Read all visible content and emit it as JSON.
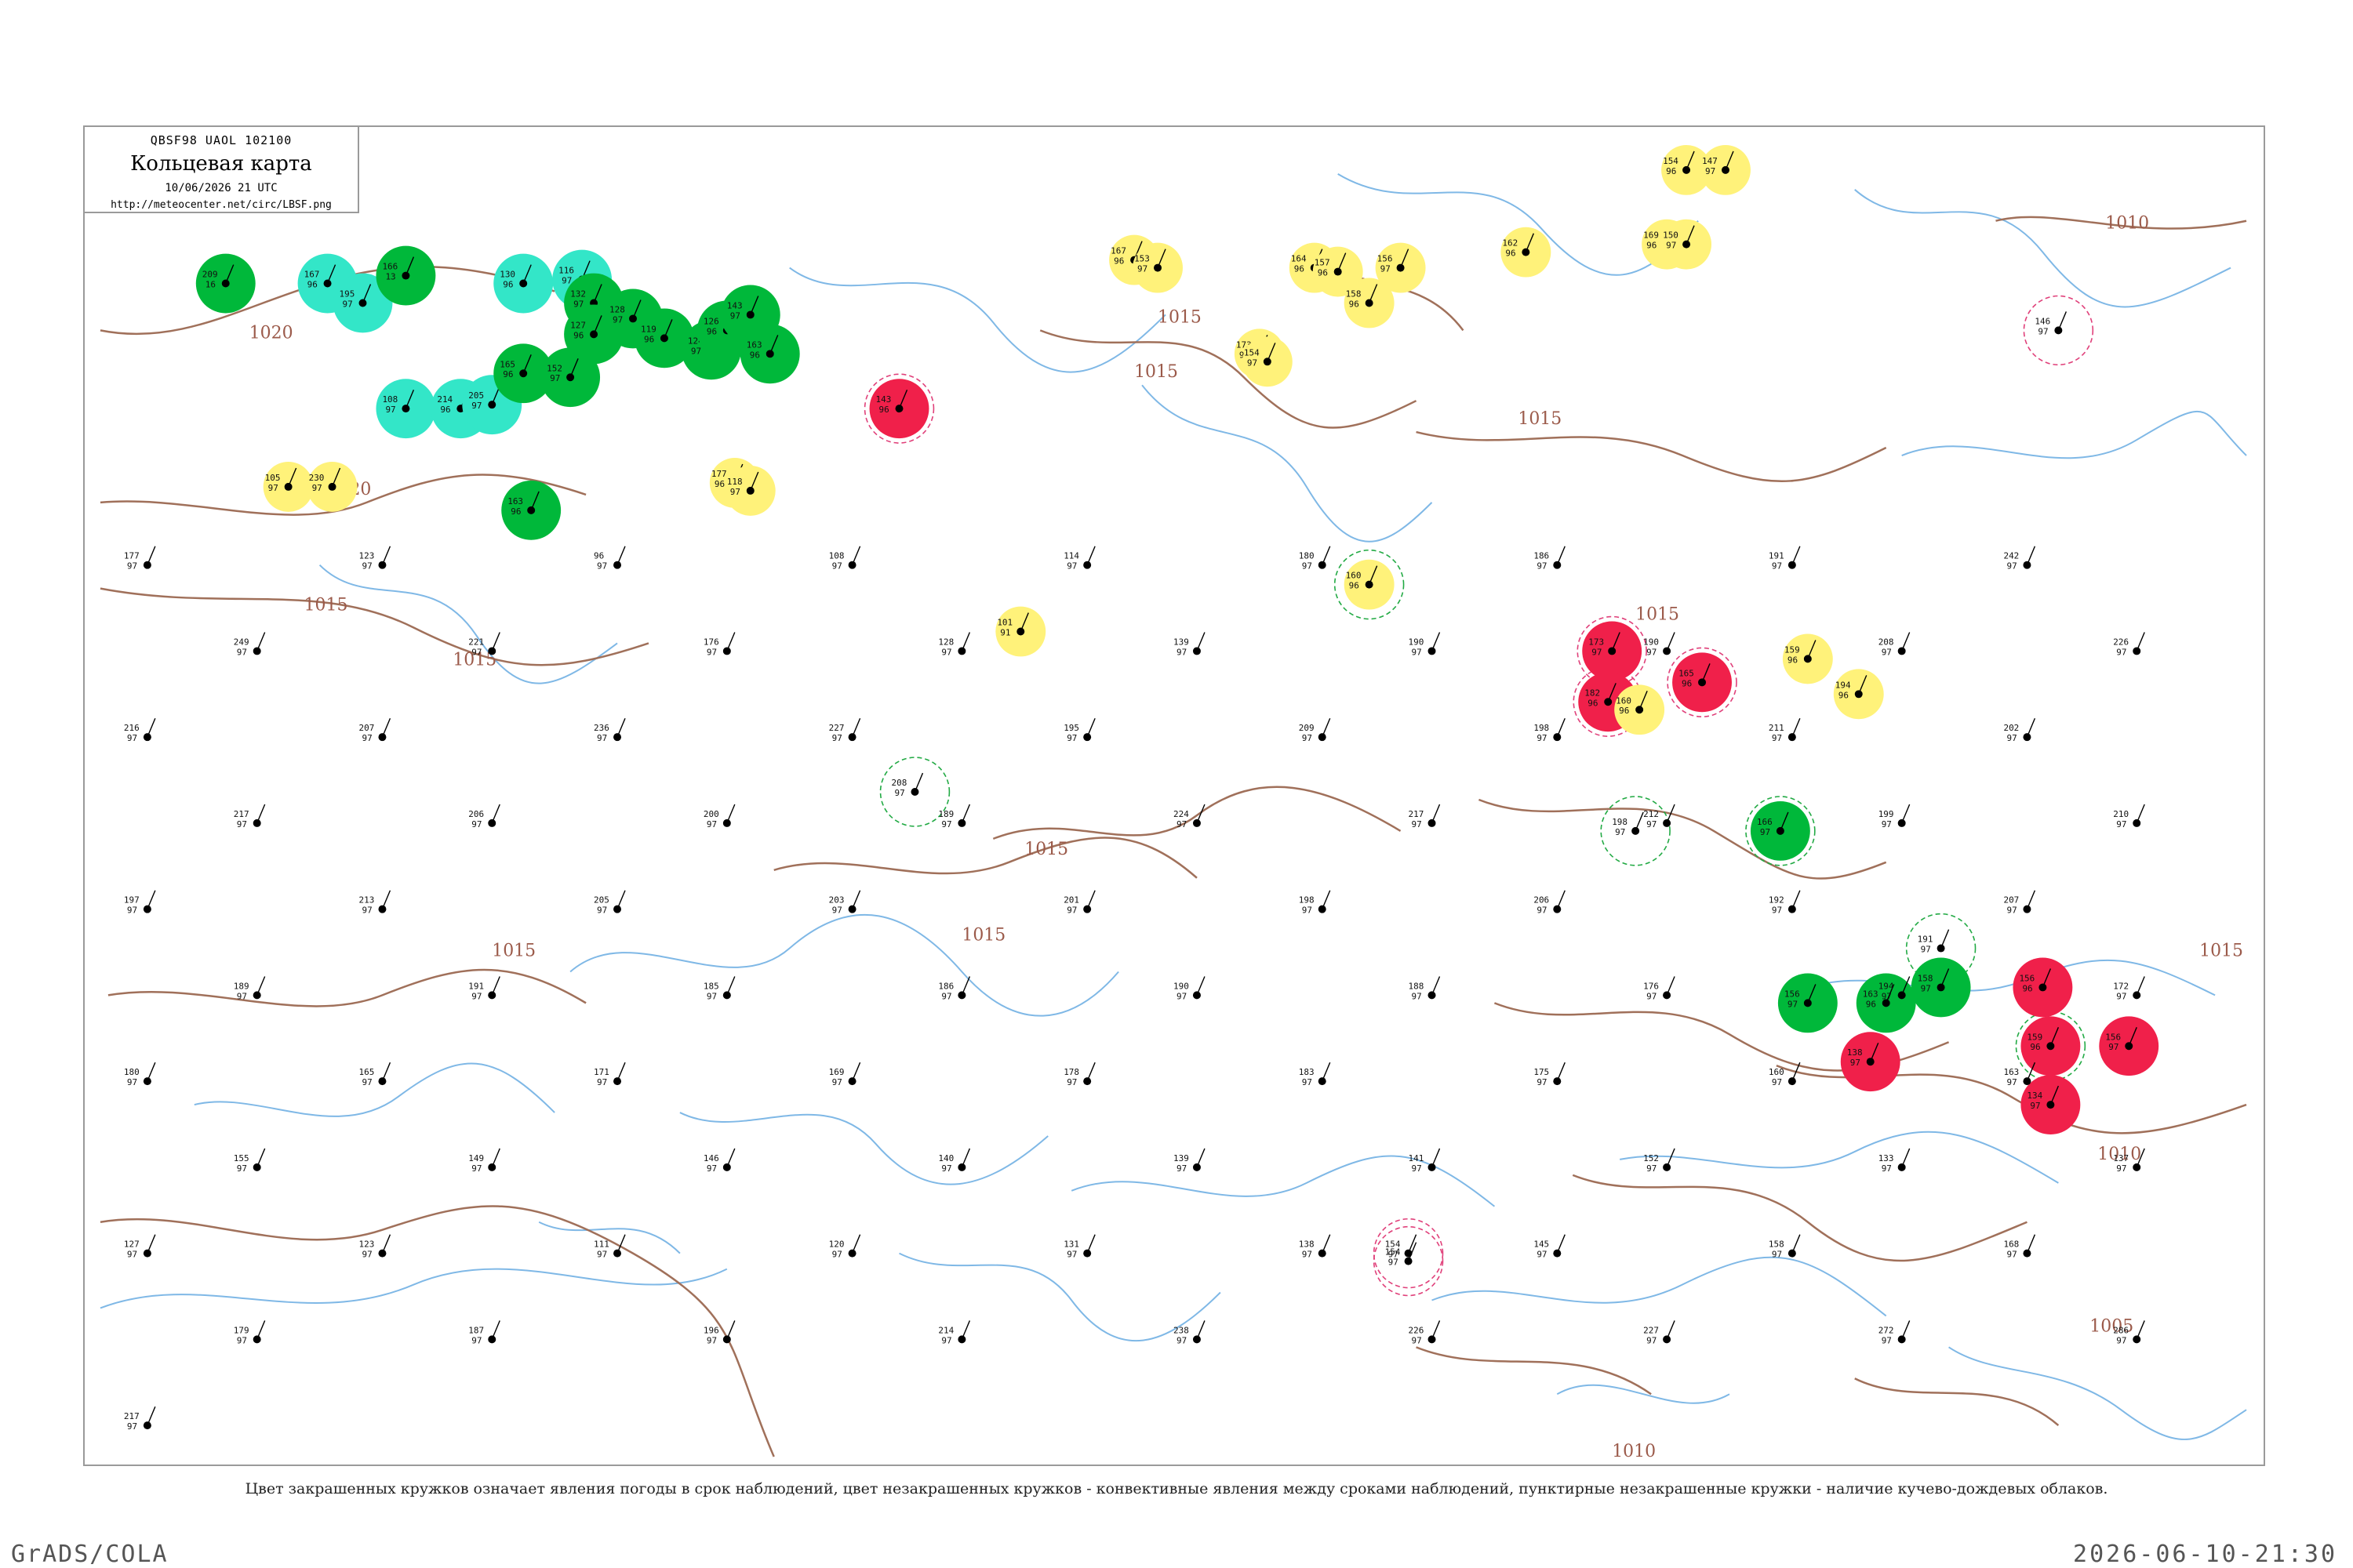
{
  "title_box": {
    "header": "QBSF98  UAOL  102100",
    "title": "Кольцевая карта",
    "date": "10/06/2026 21 UTC",
    "url": "http://meteocenter.net/circ/LBSF.png"
  },
  "caption": "Цвет закрашенных кружков означает явления погоды в срок наблюдений, цвет незакрашенных кружков - конвективные явления между сроками наблюдений, пунктирные незакрашенные кружки - наличие кучево-дождевых облаков.",
  "footer": {
    "left": "GrADS/COLA",
    "right": "2026-06-10-21:30"
  },
  "colors": {
    "green": "#00b83a",
    "cyan": "#33e6c8",
    "yellow": "#fff27a",
    "red": "#f0204a",
    "coast": "#7fb8e6",
    "isobar": "#a0705a",
    "ring_green": "#22aa44",
    "ring_red": "#e0407a"
  },
  "isobar_labels": [
    {
      "text": "1020"
    },
    {
      "text": "1020"
    },
    {
      "text": "1015"
    },
    {
      "text": "1015"
    },
    {
      "text": "1015"
    },
    {
      "text": "1015"
    },
    {
      "text": "1015"
    },
    {
      "text": "1015"
    },
    {
      "text": "1015"
    },
    {
      "text": "1015"
    },
    {
      "text": "1015"
    },
    {
      "text": "1010"
    },
    {
      "text": "1010"
    },
    {
      "text": "1010"
    },
    {
      "text": "1005"
    },
    {
      "text": "1015"
    }
  ],
  "stations": [
    {
      "t": "209",
      "p": "16",
      "id": "",
      "fill": "green",
      "ring": ""
    },
    {
      "t": "167",
      "p": "96",
      "id": "",
      "fill": "cyan",
      "ring": ""
    },
    {
      "t": "195",
      "p": "97",
      "id": "",
      "fill": "cyan",
      "ring": ""
    },
    {
      "t": "166",
      "p": "13",
      "id": "",
      "fill": "green",
      "ring": ""
    },
    {
      "t": "130",
      "p": "96",
      "id": "",
      "fill": "cyan",
      "ring": ""
    },
    {
      "t": "116",
      "p": "97",
      "id": "",
      "fill": "cyan",
      "ring": ""
    },
    {
      "t": "132",
      "p": "97",
      "id": "",
      "fill": "green",
      "ring": ""
    },
    {
      "t": "127",
      "p": "96",
      "id": "",
      "fill": "green",
      "ring": ""
    },
    {
      "t": "128",
      "p": "97",
      "id": "",
      "fill": "green",
      "ring": ""
    },
    {
      "t": "119",
      "p": "96",
      "id": "",
      "fill": "green",
      "ring": ""
    },
    {
      "t": "124",
      "p": "97",
      "id": "",
      "fill": "green",
      "ring": ""
    },
    {
      "t": "126",
      "p": "96",
      "id": "",
      "fill": "green",
      "ring": ""
    },
    {
      "t": "108",
      "p": "97",
      "id": "",
      "fill": "cyan",
      "ring": ""
    },
    {
      "t": "214",
      "p": "96",
      "id": "",
      "fill": "cyan",
      "ring": ""
    },
    {
      "t": "205",
      "p": "97",
      "id": "",
      "fill": "cyan",
      "ring": ""
    },
    {
      "t": "165",
      "p": "96",
      "id": "",
      "fill": "green",
      "ring": ""
    },
    {
      "t": "152",
      "p": "97",
      "id": "",
      "fill": "green",
      "ring": ""
    },
    {
      "t": "105",
      "p": "97",
      "id": "",
      "fill": "yellow",
      "ring": ""
    },
    {
      "t": "230",
      "p": "97",
      "id": "",
      "fill": "yellow",
      "ring": ""
    },
    {
      "t": "163",
      "p": "96",
      "id": "",
      "fill": "green",
      "ring": ""
    },
    {
      "t": "143",
      "p": "97",
      "id": "",
      "fill": "green",
      "ring": ""
    },
    {
      "t": "163",
      "p": "96",
      "id": "",
      "fill": "green",
      "ring": ""
    },
    {
      "t": "177",
      "p": "96",
      "id": "",
      "fill": "yellow",
      "ring": ""
    },
    {
      "t": "118",
      "p": "97",
      "id": "",
      "fill": "yellow",
      "ring": ""
    },
    {
      "t": "143",
      "p": "96",
      "id": "",
      "fill": "red",
      "ring": "red"
    },
    {
      "t": "101",
      "p": "91",
      "id": "",
      "fill": "yellow",
      "ring": ""
    },
    {
      "t": "167",
      "p": "96",
      "id": "",
      "fill": "yellow",
      "ring": ""
    },
    {
      "t": "153",
      "p": "97",
      "id": "",
      "fill": "yellow",
      "ring": ""
    },
    {
      "t": "173",
      "p": "97",
      "id": "",
      "fill": "yellow",
      "ring": ""
    },
    {
      "t": "154",
      "p": "97",
      "id": "",
      "fill": "yellow",
      "ring": ""
    },
    {
      "t": "164",
      "p": "96",
      "id": "",
      "fill": "yellow",
      "ring": ""
    },
    {
      "t": "157",
      "p": "96",
      "id": "",
      "fill": "yellow",
      "ring": ""
    },
    {
      "t": "156",
      "p": "97",
      "id": "",
      "fill": "yellow",
      "ring": ""
    },
    {
      "t": "158",
      "p": "96",
      "id": "",
      "fill": "yellow",
      "ring": ""
    },
    {
      "t": "162",
      "p": "96",
      "id": "",
      "fill": "yellow",
      "ring": ""
    },
    {
      "t": "169",
      "p": "96",
      "id": "",
      "fill": "yellow",
      "ring": ""
    },
    {
      "t": "150",
      "p": "97",
      "id": "",
      "fill": "yellow",
      "ring": ""
    },
    {
      "t": "154",
      "p": "96",
      "id": "",
      "fill": "yellow",
      "ring": ""
    },
    {
      "t": "147",
      "p": "97",
      "id": "",
      "fill": "yellow",
      "ring": ""
    },
    {
      "t": "160",
      "p": "96",
      "id": "",
      "fill": "yellow",
      "ring": "green"
    },
    {
      "t": "173",
      "p": "97",
      "id": "",
      "fill": "red",
      "ring": "red"
    },
    {
      "t": "182",
      "p": "96",
      "id": "",
      "fill": "red",
      "ring": "red"
    },
    {
      "t": "160",
      "p": "96",
      "id": "",
      "fill": "yellow",
      "ring": ""
    },
    {
      "t": "165",
      "p": "96",
      "id": "",
      "fill": "red",
      "ring": "red"
    },
    {
      "t": "159",
      "p": "96",
      "id": "",
      "fill": "yellow",
      "ring": ""
    },
    {
      "t": "194",
      "p": "96",
      "id": "",
      "fill": "yellow",
      "ring": ""
    },
    {
      "t": "166",
      "p": "97",
      "id": "",
      "fill": "green",
      "ring": "green"
    },
    {
      "t": "156",
      "p": "97",
      "id": "",
      "fill": "green",
      "ring": ""
    },
    {
      "t": "163",
      "p": "96",
      "id": "",
      "fill": "green",
      "ring": ""
    },
    {
      "t": "138",
      "p": "97",
      "id": "",
      "fill": "red",
      "ring": ""
    },
    {
      "t": "158",
      "p": "97",
      "id": "",
      "fill": "green",
      "ring": ""
    },
    {
      "t": "156",
      "p": "96",
      "id": "",
      "fill": "red",
      "ring": ""
    },
    {
      "t": "159",
      "p": "96",
      "id": "",
      "fill": "red",
      "ring": "green"
    },
    {
      "t": "156",
      "p": "97",
      "id": "",
      "fill": "red",
      "ring": ""
    },
    {
      "t": "134",
      "p": "97",
      "id": "",
      "fill": "red",
      "ring": ""
    },
    {
      "t": "198",
      "p": "97",
      "id": "",
      "fill": "none",
      "ring": "green"
    },
    {
      "t": "191",
      "p": "97",
      "id": "",
      "fill": "none",
      "ring": "green"
    },
    {
      "t": "208",
      "p": "97",
      "id": "",
      "fill": "none",
      "ring": "green"
    },
    {
      "t": "154",
      "p": "97",
      "id": "",
      "fill": "none",
      "ring": "red"
    },
    {
      "t": "154",
      "p": "97",
      "id": "",
      "fill": "none",
      "ring": "red"
    },
    {
      "t": "146",
      "p": "97",
      "id": "",
      "fill": "none",
      "ring": "red"
    },
    {
      "t": "177",
      "p": "97",
      "id": "",
      "fill": "none",
      "ring": ""
    },
    {
      "t": "123",
      "p": "97",
      "id": "",
      "fill": "none",
      "ring": ""
    },
    {
      "t": "96",
      "p": "97",
      "id": "",
      "fill": "none",
      "ring": ""
    },
    {
      "t": "108",
      "p": "97",
      "id": "",
      "fill": "none",
      "ring": ""
    },
    {
      "t": "114",
      "p": "97",
      "id": "",
      "fill": "none",
      "ring": ""
    },
    {
      "t": "180",
      "p": "97",
      "id": "",
      "fill": "none",
      "ring": ""
    },
    {
      "t": "186",
      "p": "97",
      "id": "",
      "fill": "none",
      "ring": ""
    },
    {
      "t": "191",
      "p": "97",
      "id": "",
      "fill": "none",
      "ring": ""
    },
    {
      "t": "242",
      "p": "97",
      "id": "",
      "fill": "none",
      "ring": ""
    },
    {
      "t": "249",
      "p": "97",
      "id": "",
      "fill": "none",
      "ring": ""
    },
    {
      "t": "221",
      "p": "97",
      "id": "",
      "fill": "none",
      "ring": ""
    },
    {
      "t": "176",
      "p": "97",
      "id": "",
      "fill": "none",
      "ring": ""
    },
    {
      "t": "128",
      "p": "97",
      "id": "",
      "fill": "none",
      "ring": ""
    },
    {
      "t": "139",
      "p": "97",
      "id": "",
      "fill": "none",
      "ring": ""
    },
    {
      "t": "190",
      "p": "97",
      "id": "",
      "fill": "none",
      "ring": ""
    },
    {
      "t": "190",
      "p": "97",
      "id": "",
      "fill": "none",
      "ring": ""
    },
    {
      "t": "208",
      "p": "97",
      "id": "",
      "fill": "none",
      "ring": ""
    },
    {
      "t": "226",
      "p": "97",
      "id": "",
      "fill": "none",
      "ring": ""
    },
    {
      "t": "216",
      "p": "97",
      "id": "",
      "fill": "none",
      "ring": ""
    },
    {
      "t": "207",
      "p": "97",
      "id": "",
      "fill": "none",
      "ring": ""
    },
    {
      "t": "236",
      "p": "97",
      "id": "",
      "fill": "none",
      "ring": ""
    },
    {
      "t": "227",
      "p": "97",
      "id": "",
      "fill": "none",
      "ring": ""
    },
    {
      "t": "195",
      "p": "97",
      "id": "",
      "fill": "none",
      "ring": ""
    },
    {
      "t": "209",
      "p": "97",
      "id": "",
      "fill": "none",
      "ring": ""
    },
    {
      "t": "198",
      "p": "97",
      "id": "",
      "fill": "none",
      "ring": ""
    },
    {
      "t": "211",
      "p": "97",
      "id": "",
      "fill": "none",
      "ring": ""
    },
    {
      "t": "202",
      "p": "97",
      "id": "",
      "fill": "none",
      "ring": ""
    },
    {
      "t": "217",
      "p": "97",
      "id": "",
      "fill": "none",
      "ring": ""
    },
    {
      "t": "206",
      "p": "97",
      "id": "",
      "fill": "none",
      "ring": ""
    },
    {
      "t": "200",
      "p": "97",
      "id": "",
      "fill": "none",
      "ring": ""
    },
    {
      "t": "189",
      "p": "97",
      "id": "",
      "fill": "none",
      "ring": ""
    },
    {
      "t": "224",
      "p": "97",
      "id": "",
      "fill": "none",
      "ring": ""
    },
    {
      "t": "217",
      "p": "97",
      "id": "",
      "fill": "none",
      "ring": ""
    },
    {
      "t": "212",
      "p": "97",
      "id": "",
      "fill": "none",
      "ring": ""
    },
    {
      "t": "199",
      "p": "97",
      "id": "",
      "fill": "none",
      "ring": ""
    },
    {
      "t": "210",
      "p": "97",
      "id": "",
      "fill": "none",
      "ring": ""
    },
    {
      "t": "197",
      "p": "97",
      "id": "",
      "fill": "none",
      "ring": ""
    },
    {
      "t": "213",
      "p": "97",
      "id": "",
      "fill": "none",
      "ring": ""
    },
    {
      "t": "205",
      "p": "97",
      "id": "",
      "fill": "none",
      "ring": ""
    },
    {
      "t": "203",
      "p": "97",
      "id": "",
      "fill": "none",
      "ring": ""
    },
    {
      "t": "201",
      "p": "97",
      "id": "",
      "fill": "none",
      "ring": ""
    },
    {
      "t": "198",
      "p": "97",
      "id": "",
      "fill": "none",
      "ring": ""
    },
    {
      "t": "206",
      "p": "97",
      "id": "",
      "fill": "none",
      "ring": ""
    },
    {
      "t": "192",
      "p": "97",
      "id": "",
      "fill": "none",
      "ring": ""
    },
    {
      "t": "207",
      "p": "97",
      "id": "",
      "fill": "none",
      "ring": ""
    },
    {
      "t": "189",
      "p": "97",
      "id": "",
      "fill": "none",
      "ring": ""
    },
    {
      "t": "191",
      "p": "97",
      "id": "",
      "fill": "none",
      "ring": ""
    },
    {
      "t": "185",
      "p": "97",
      "id": "",
      "fill": "none",
      "ring": ""
    },
    {
      "t": "186",
      "p": "97",
      "id": "",
      "fill": "none",
      "ring": ""
    },
    {
      "t": "190",
      "p": "97",
      "id": "",
      "fill": "none",
      "ring": ""
    },
    {
      "t": "188",
      "p": "97",
      "id": "",
      "fill": "none",
      "ring": ""
    },
    {
      "t": "176",
      "p": "97",
      "id": "",
      "fill": "none",
      "ring": ""
    },
    {
      "t": "194",
      "p": "97",
      "id": "",
      "fill": "none",
      "ring": ""
    },
    {
      "t": "172",
      "p": "97",
      "id": "",
      "fill": "none",
      "ring": ""
    },
    {
      "t": "180",
      "p": "97",
      "id": "",
      "fill": "none",
      "ring": ""
    },
    {
      "t": "165",
      "p": "97",
      "id": "",
      "fill": "none",
      "ring": ""
    },
    {
      "t": "171",
      "p": "97",
      "id": "",
      "fill": "none",
      "ring": ""
    },
    {
      "t": "169",
      "p": "97",
      "id": "",
      "fill": "none",
      "ring": ""
    },
    {
      "t": "178",
      "p": "97",
      "id": "",
      "fill": "none",
      "ring": ""
    },
    {
      "t": "183",
      "p": "97",
      "id": "",
      "fill": "none",
      "ring": ""
    },
    {
      "t": "175",
      "p": "97",
      "id": "",
      "fill": "none",
      "ring": ""
    },
    {
      "t": "160",
      "p": "97",
      "id": "",
      "fill": "none",
      "ring": ""
    },
    {
      "t": "163",
      "p": "97",
      "id": "",
      "fill": "none",
      "ring": ""
    },
    {
      "t": "155",
      "p": "97",
      "id": "",
      "fill": "none",
      "ring": ""
    },
    {
      "t": "149",
      "p": "97",
      "id": "",
      "fill": "none",
      "ring": ""
    },
    {
      "t": "146",
      "p": "97",
      "id": "",
      "fill": "none",
      "ring": ""
    },
    {
      "t": "140",
      "p": "97",
      "id": "",
      "fill": "none",
      "ring": ""
    },
    {
      "t": "139",
      "p": "97",
      "id": "",
      "fill": "none",
      "ring": ""
    },
    {
      "t": "141",
      "p": "97",
      "id": "",
      "fill": "none",
      "ring": ""
    },
    {
      "t": "152",
      "p": "97",
      "id": "",
      "fill": "none",
      "ring": ""
    },
    {
      "t": "133",
      "p": "97",
      "id": "",
      "fill": "none",
      "ring": ""
    },
    {
      "t": "137",
      "p": "97",
      "id": "",
      "fill": "none",
      "ring": ""
    },
    {
      "t": "127",
      "p": "97",
      "id": "",
      "fill": "none",
      "ring": ""
    },
    {
      "t": "123",
      "p": "97",
      "id": "",
      "fill": "none",
      "ring": ""
    },
    {
      "t": "111",
      "p": "97",
      "id": "",
      "fill": "none",
      "ring": ""
    },
    {
      "t": "120",
      "p": "97",
      "id": "",
      "fill": "none",
      "ring": ""
    },
    {
      "t": "131",
      "p": "97",
      "id": "",
      "fill": "none",
      "ring": ""
    },
    {
      "t": "138",
      "p": "97",
      "id": "",
      "fill": "none",
      "ring": ""
    },
    {
      "t": "145",
      "p": "97",
      "id": "",
      "fill": "none",
      "ring": ""
    },
    {
      "t": "158",
      "p": "97",
      "id": "",
      "fill": "none",
      "ring": ""
    },
    {
      "t": "168",
      "p": "97",
      "id": "",
      "fill": "none",
      "ring": ""
    },
    {
      "t": "179",
      "p": "97",
      "id": "",
      "fill": "none",
      "ring": ""
    },
    {
      "t": "187",
      "p": "97",
      "id": "",
      "fill": "none",
      "ring": ""
    },
    {
      "t": "196",
      "p": "97",
      "id": "",
      "fill": "none",
      "ring": ""
    },
    {
      "t": "214",
      "p": "97",
      "id": "",
      "fill": "none",
      "ring": ""
    },
    {
      "t": "238",
      "p": "97",
      "id": "",
      "fill": "none",
      "ring": ""
    },
    {
      "t": "226",
      "p": "97",
      "id": "",
      "fill": "none",
      "ring": ""
    },
    {
      "t": "227",
      "p": "97",
      "id": "",
      "fill": "none",
      "ring": ""
    },
    {
      "t": "272",
      "p": "97",
      "id": "",
      "fill": "none",
      "ring": ""
    },
    {
      "t": "286",
      "p": "97",
      "id": "",
      "fill": "none",
      "ring": ""
    },
    {
      "t": "217",
      "p": "97",
      "id": "",
      "fill": "none",
      "ring": ""
    }
  ]
}
